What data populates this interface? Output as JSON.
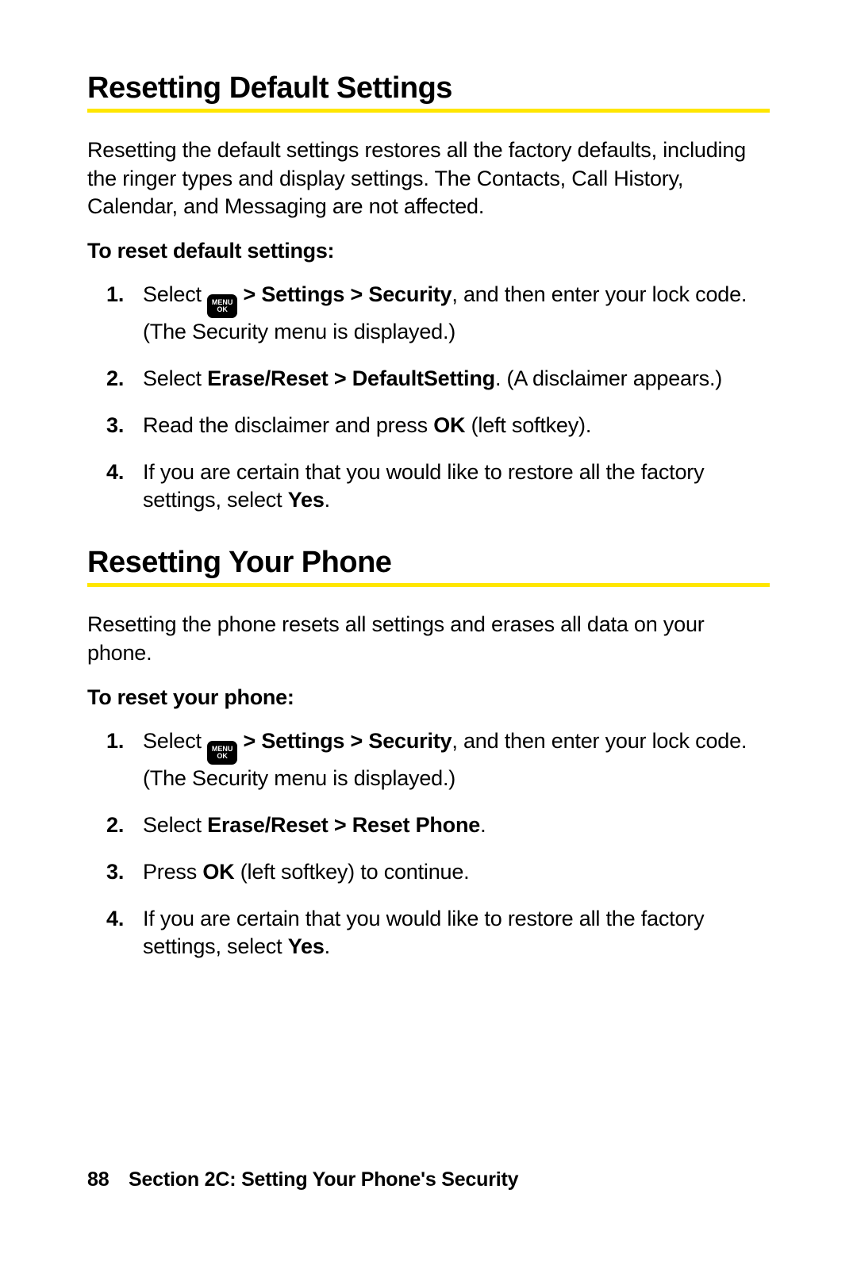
{
  "section1": {
    "heading": "Resetting Default Settings",
    "intro": "Resetting the default settings restores all the factory defaults, including the ringer types and display settings. The Contacts, Call History, Calendar, and Messaging are not affected.",
    "subhead": "To reset default settings:",
    "steps": {
      "s1_a": "Select ",
      "s1_b": " > Settings > Security",
      "s1_c": ", and then enter your lock code. (The Security menu is displayed.)",
      "s2_a": "Select ",
      "s2_b": "Erase/Reset > DefaultSetting",
      "s2_c": ". (A disclaimer appears.)",
      "s3_a": "Read the disclaimer and press ",
      "s3_b": "OK",
      "s3_c": " (left softkey).",
      "s4_a": "If you are certain that you would like to restore all the factory settings, select ",
      "s4_b": "Yes",
      "s4_c": "."
    }
  },
  "section2": {
    "heading": "Resetting Your Phone",
    "intro": "Resetting the phone resets all settings and erases all data on your phone.",
    "subhead": "To reset your phone:",
    "steps": {
      "s1_a": "Select ",
      "s1_b": " > Settings > Security",
      "s1_c": ", and then enter your lock code. (The Security menu is displayed.)",
      "s2_a": "Select ",
      "s2_b": "Erase/Reset > Reset Phone",
      "s2_c": ".",
      "s3_a": "Press ",
      "s3_b": "OK",
      "s3_c": " (left softkey) to continue.",
      "s4_a": "If you are certain that you would like to restore all the factory settings, select ",
      "s4_b": "Yes",
      "s4_c": "."
    }
  },
  "key": {
    "top": "MENU",
    "bot": "OK"
  },
  "nums": {
    "n1": "1.",
    "n2": "2.",
    "n3": "3.",
    "n4": "4."
  },
  "footer": {
    "page": "88",
    "text": "Section 2C: Setting Your Phone's Security"
  }
}
